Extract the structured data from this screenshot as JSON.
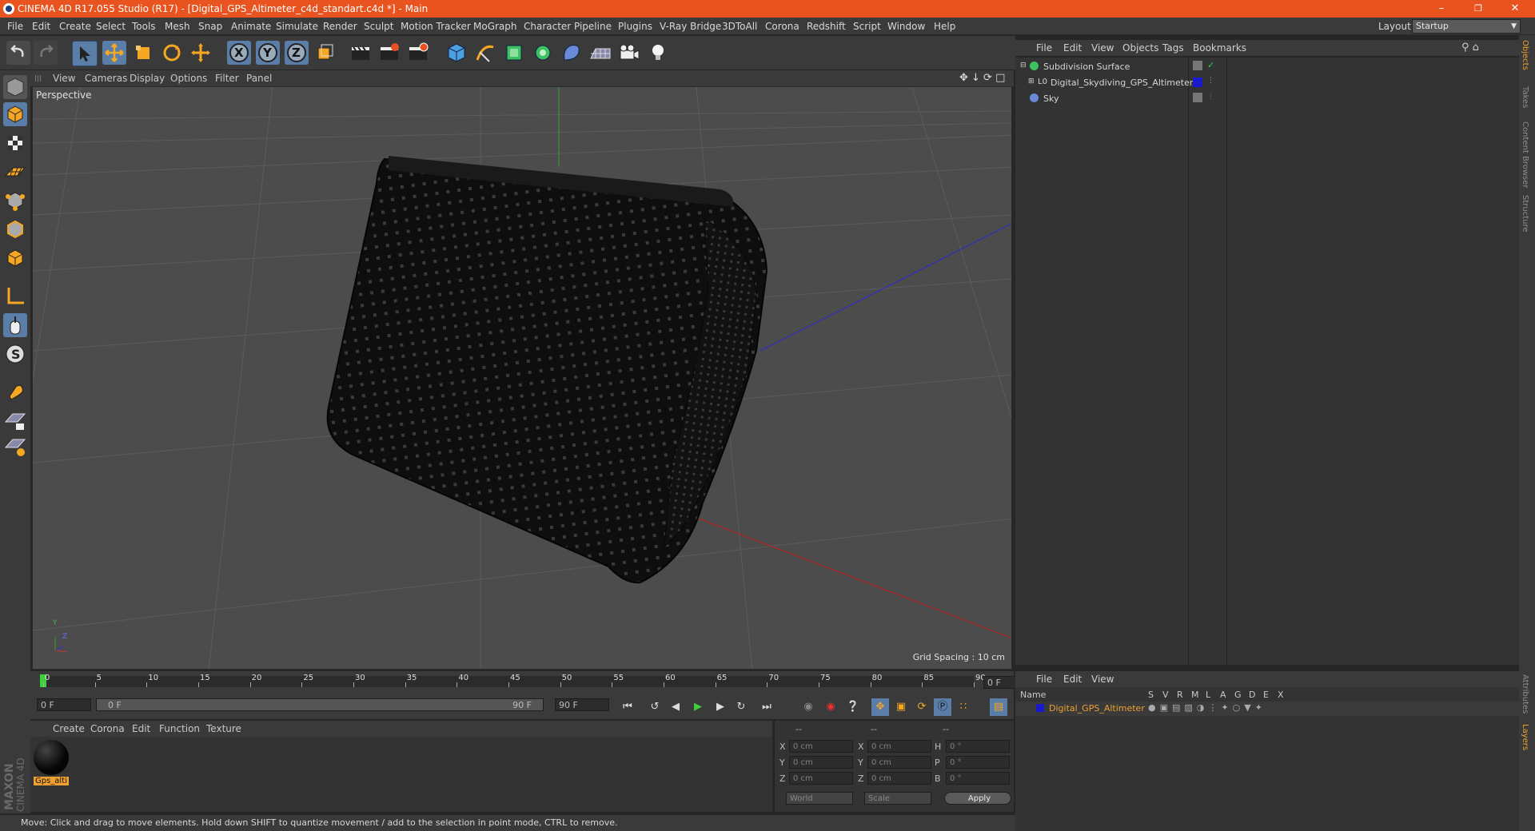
{
  "window": {
    "title": "CINEMA 4D R17.055 Studio (R17) - [Digital_GPS_Altimeter_c4d_standart.c4d *] - Main",
    "minimize": "–",
    "restore": "❐",
    "close": "✕"
  },
  "menubar": {
    "items": [
      "File",
      "Edit",
      "Create",
      "Select",
      "Tools",
      "Mesh",
      "Snap",
      "Animate",
      "Simulate",
      "Render",
      "Sculpt",
      "Motion Tracker",
      "MoGraph",
      "Character",
      "Pipeline",
      "Plugins",
      "V-Ray Bridge",
      "3DToAll",
      "Corona",
      "Redshift",
      "Script",
      "Window",
      "Help"
    ],
    "layout_label": "Layout:",
    "layout_value": "Startup"
  },
  "toolbar": {
    "axis_labels": [
      "X",
      "Y",
      "Z"
    ],
    "icons": [
      "undo-icon",
      "redo-icon",
      "select-icon",
      "move-icon",
      "scale-icon",
      "rotate-icon",
      "transform-icon",
      "x-axis-icon",
      "y-axis-icon",
      "z-axis-icon",
      "coordinate-system-icon",
      "render-view-icon",
      "render-picture-viewer-icon",
      "render-settings-icon",
      "cube-primitive-icon",
      "spline-pen-icon",
      "subdivision-icon",
      "array-icon",
      "deformer-icon",
      "floor-icon",
      "camera-icon",
      "light-icon"
    ]
  },
  "viewport": {
    "menu": [
      "View",
      "Cameras",
      "Display",
      "Options",
      "Filter",
      "Panel"
    ],
    "label": "Perspective",
    "grid_spacing": "Grid Spacing : 10 cm",
    "axis_gizmo": {
      "y": "Y",
      "z": "Z"
    }
  },
  "timeline": {
    "ticks": [
      "0",
      "5",
      "10",
      "15",
      "20",
      "25",
      "30",
      "35",
      "40",
      "45",
      "50",
      "55",
      "60",
      "65",
      "70",
      "75",
      "80",
      "85",
      "90"
    ],
    "current_frame": "0 F",
    "start_field": "0 F",
    "range_start": "0 F",
    "range_end": "90 F",
    "end_field": "90 F"
  },
  "material_manager": {
    "menu": [
      "Create",
      "Corona",
      "Edit",
      "Function",
      "Texture"
    ],
    "material_name": "Gps_alti"
  },
  "coordinates": {
    "headers": [
      "--",
      "--",
      "--"
    ],
    "rows": [
      {
        "l1": "X",
        "v1": "0 cm",
        "l2": "X",
        "v2": "0 cm",
        "l3": "H",
        "v3": "0 °"
      },
      {
        "l1": "Y",
        "v1": "0 cm",
        "l2": "Y",
        "v2": "0 cm",
        "l3": "P",
        "v3": "0 °"
      },
      {
        "l1": "Z",
        "v1": "0 cm",
        "l2": "Z",
        "v2": "0 cm",
        "l3": "B",
        "v3": "0 °"
      }
    ],
    "mode1": "World",
    "mode2": "Scale",
    "apply": "Apply"
  },
  "statusbar": {
    "text": "Move: Click and drag to move elements. Hold down SHIFT to quantize movement / add to the selection in point mode, CTRL to remove."
  },
  "object_manager": {
    "menu": [
      "File",
      "Edit",
      "View",
      "Objects",
      "Tags",
      "Bookmarks"
    ],
    "objects": [
      {
        "name": "Subdivision Surface",
        "icon": "subdivision-surface-icon"
      },
      {
        "name": "Digital_Skydiving_GPS_Altimeter",
        "icon": "null-object-icon"
      },
      {
        "name": "Sky",
        "icon": "sky-icon"
      }
    ]
  },
  "side_tabs": {
    "top": [
      "Objects",
      "Takes",
      "Content Browser",
      "Structure"
    ],
    "bottom": [
      "Attributes",
      "Layers"
    ]
  },
  "layer_manager": {
    "menu": [
      "File",
      "Edit",
      "View"
    ],
    "name_header": "Name",
    "columns": [
      "S",
      "V",
      "R",
      "M",
      "L",
      "A",
      "G",
      "D",
      "E",
      "X"
    ],
    "layer_name": "Digital_GPS_Altimeter"
  },
  "branding": {
    "logo_text": "MAXON CINEMA 4D"
  },
  "colors": {
    "title_bar": "#e8531f",
    "accent_orange": "#f0a030",
    "layer_blue": "#1a1acc",
    "material_label_bg": "#f0a030"
  }
}
